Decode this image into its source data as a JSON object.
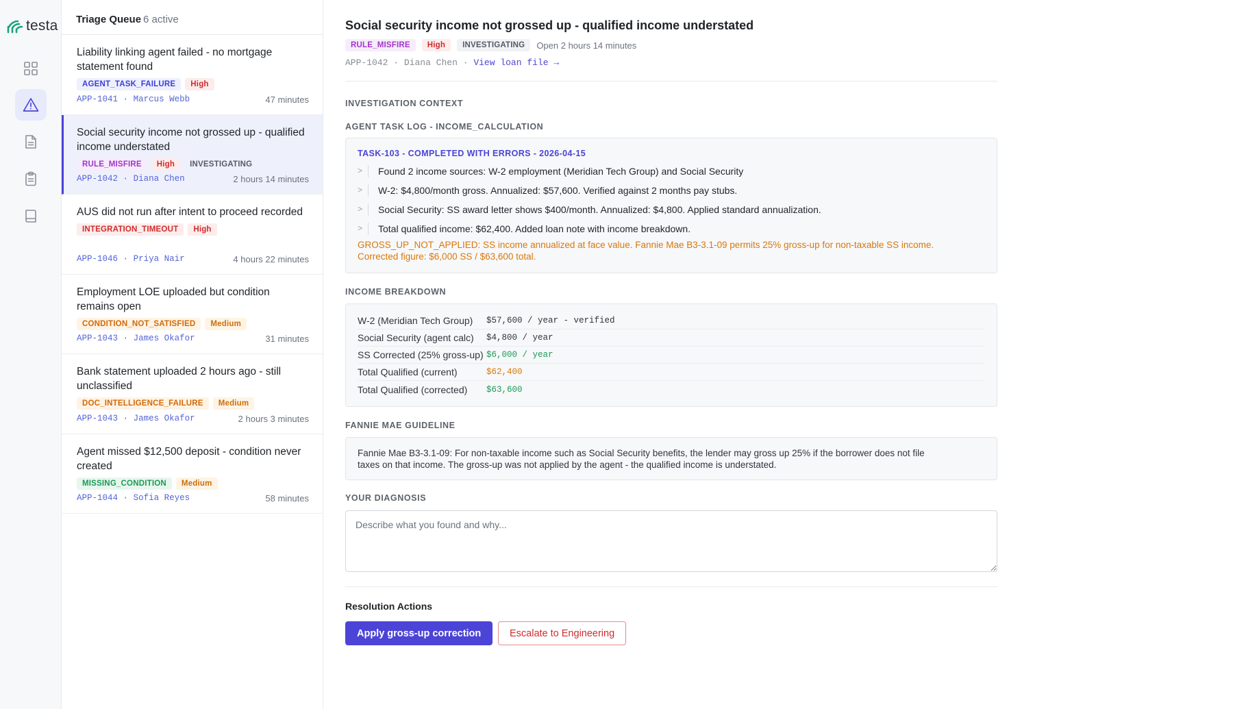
{
  "app": {
    "logo_text": "testa",
    "brand_color": "#1aa37a",
    "accent_color": "#4b44d6"
  },
  "rail": {
    "items": [
      {
        "icon": "grid-icon"
      },
      {
        "icon": "alert-triangle-icon",
        "active": true
      },
      {
        "icon": "document-icon"
      },
      {
        "icon": "clipboard-icon"
      },
      {
        "icon": "book-icon"
      }
    ]
  },
  "queue": {
    "title": "Triage Queue",
    "count": "6 active",
    "items": [
      {
        "title": "Liability linking agent failed - no mortgage statement found",
        "category": "AGENT_TASK_FAILURE",
        "severity": "High",
        "status": "",
        "ref": "APP-1041",
        "person": "Marcus Webb",
        "age": "47 minutes"
      },
      {
        "title": "Social security income not grossed up - qualified income understated",
        "category": "RULE_MISFIRE",
        "severity": "High",
        "status": "INVESTIGATING",
        "ref": "APP-1042",
        "person": "Diana Chen",
        "age": "2 hours 14 minutes"
      },
      {
        "title": "AUS did not run after intent to proceed recorded",
        "category": "INTEGRATION_TIMEOUT",
        "severity": "High",
        "status": "",
        "ref": "APP-1046",
        "person": "Priya Nair",
        "age": "4 hours 22 minutes"
      },
      {
        "title": "Employment LOE uploaded but condition remains open",
        "category": "CONDITION_NOT_SATISFIED",
        "severity": "Medium",
        "status": "",
        "ref": "APP-1043",
        "person": "James Okafor",
        "age": "31 minutes"
      },
      {
        "title": "Bank statement uploaded 2 hours ago - still unclassified",
        "category": "DOC_INTELLIGENCE_FAILURE",
        "severity": "Medium",
        "status": "",
        "ref": "APP-1043",
        "person": "James Okafor",
        "age": "2 hours 3 minutes"
      },
      {
        "title": "Agent missed $12,500 deposit - condition never created",
        "category": "MISSING_CONDITION",
        "severity": "Medium",
        "status": "",
        "ref": "APP-1044",
        "person": "Sofia Reyes",
        "age": "58 minutes"
      }
    ]
  },
  "case": {
    "title": "Social security income not grossed up - qualified income understated",
    "category": "RULE_MISFIRE",
    "severity": "High",
    "status": "INVESTIGATING",
    "open_for": "Open 2 hours 14 minutes",
    "ref": "APP-1042",
    "person": "Diana Chen",
    "link_text": "View loan file →",
    "sep": "·"
  },
  "context": {
    "section_label": "INVESTIGATION CONTEXT",
    "log_label": "AGENT TASK LOG - INCOME_CALCULATION",
    "log_head": "TASK-103 - COMPLETED WITH ERRORS - 2026-04-15",
    "log_chevron": ">",
    "log_lines": [
      "Found 2 income sources: W-2 employment (Meridian Tech Group) and Social Security",
      "W-2: $4,800/month gross. Annualized: $57,600. Verified against 2 months pay stubs.",
      "Social Security: SS award letter shows $400/month. Annualized: $4,800. Applied standard annualization.",
      "Total qualified income: $62,400. Added loan note with income breakdown."
    ],
    "log_error_line1": "GROSS_UP_NOT_APPLIED: SS income annualized at face value. Fannie Mae B3-3.1-09 permits 25% gross-up for non-taxable SS income.",
    "log_error_line2": "Corrected figure: $6,000 SS / $63,600 total."
  },
  "income": {
    "section_label": "INCOME BREAKDOWN",
    "rows": [
      {
        "label": "W-2 (Meridian Tech Group)",
        "value": "$57,600 / year - verified",
        "color": "default"
      },
      {
        "label": "Social Security (agent calc)",
        "value": "$4,800 / year",
        "color": "default"
      },
      {
        "label": "SS Corrected (25% gross-up)",
        "value": "$6,000 / year",
        "color": "green"
      },
      {
        "label": "Total Qualified (current)",
        "value": "$62,400",
        "color": "orange"
      },
      {
        "label": "Total Qualified (corrected)",
        "value": "$63,600",
        "color": "green"
      }
    ]
  },
  "guideline": {
    "section_label": "FANNIE MAE GUIDELINE",
    "line1": "Fannie Mae B3-3.1-09: For non-taxable income such as Social Security benefits, the lender may gross up 25% if the borrower does not file",
    "line2": "taxes on that income. The gross-up was not applied by the agent - the qualified income is understated."
  },
  "diagnosis": {
    "section_label": "YOUR DIAGNOSIS",
    "placeholder": "Describe what you found and why...",
    "value": ""
  },
  "resolution": {
    "label": "Resolution Actions",
    "apply_label": "Apply gross-up correction",
    "escalate_label": "Escalate to Engineering"
  }
}
